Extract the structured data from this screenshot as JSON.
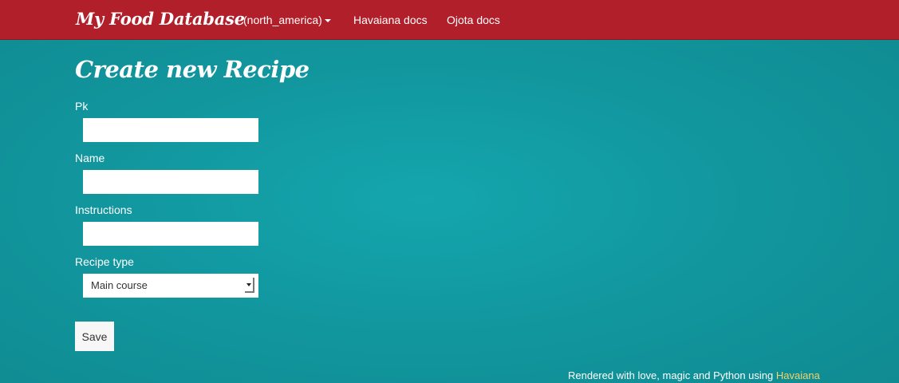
{
  "navbar": {
    "brand": "My Food Database",
    "region_label": "(north_america)",
    "links": [
      "Havaiana docs",
      "Ojota docs"
    ]
  },
  "page": {
    "title": "Create new Recipe"
  },
  "form": {
    "fields": [
      {
        "label": "Pk",
        "value": ""
      },
      {
        "label": "Name",
        "value": ""
      },
      {
        "label": "Instructions",
        "value": ""
      }
    ],
    "recipe_type": {
      "label": "Recipe type",
      "selected": "Main course"
    },
    "save_label": "Save"
  },
  "footer": {
    "text": "Rendered with love, magic and Python using ",
    "link": "Havaiana"
  },
  "colors": {
    "navbar": "#b01f2a",
    "background": "#12979f",
    "footer_link": "#f0d36a"
  }
}
